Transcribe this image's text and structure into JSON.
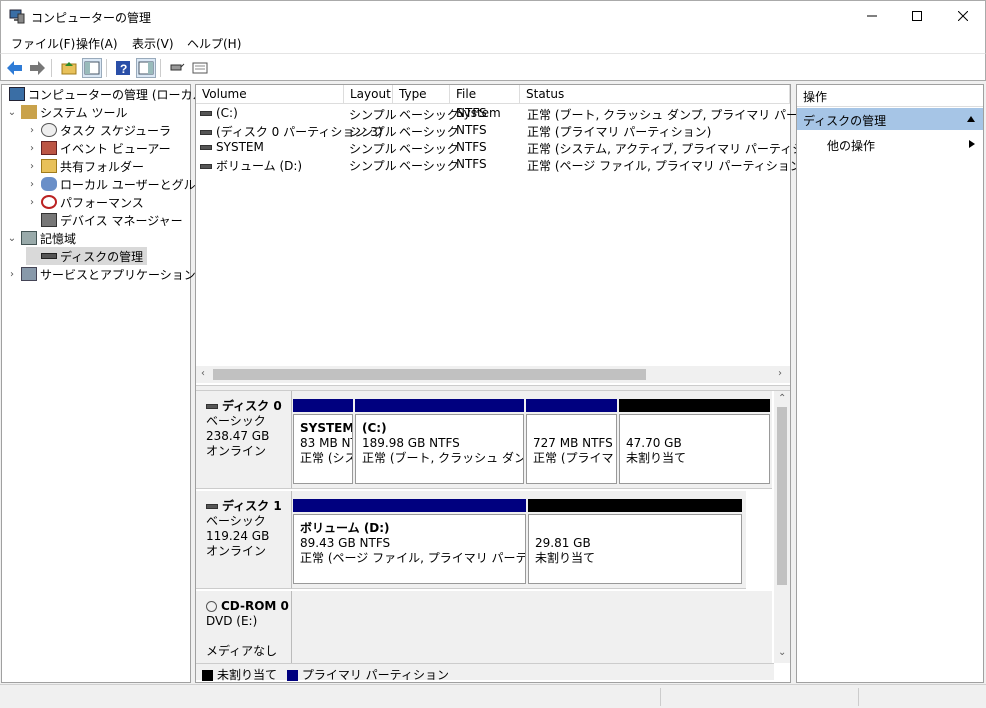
{
  "window": {
    "title": "コンピューターの管理"
  },
  "menu": [
    "ファイル(F)",
    "操作(A)",
    "表示(V)",
    "ヘルプ(H)"
  ],
  "tree": {
    "root": "コンピューターの管理 (ローカル)",
    "system_tools": "システム ツール",
    "task_scheduler": "タスク スケジューラ",
    "event_viewer": "イベント ビューアー",
    "shared_folders": "共有フォルダー",
    "local_users": "ローカル ユーザーとグループ",
    "performance": "パフォーマンス",
    "device_manager": "デバイス マネージャー",
    "storage": "記憶域",
    "disk_management": "ディスクの管理",
    "services_apps": "サービスとアプリケーション"
  },
  "volume_table": {
    "headers": [
      "Volume",
      "Layout",
      "Type",
      "File System",
      "Status"
    ],
    "rows": [
      [
        "(C:)",
        "シンプル",
        "ベーシック",
        "NTFS",
        "正常 (ブート, クラッシュ ダンプ, プライマリ パーティション)"
      ],
      [
        "(ディスク 0 パーティション 3)",
        "シンプル",
        "ベーシック",
        "NTFS",
        "正常 (プライマリ パーティション)"
      ],
      [
        "SYSTEM",
        "シンプル",
        "ベーシック",
        "NTFS",
        "正常 (システム, アクティブ, プライマリ パーティション)"
      ],
      [
        "ボリューム (D:)",
        "シンプル",
        "ベーシック",
        "NTFS",
        "正常 (ページ ファイル, プライマリ パーティション)"
      ]
    ]
  },
  "disks": [
    {
      "name": "ディスク 0",
      "type": "ベーシック",
      "size": "238.47 GB",
      "state": "オンライン",
      "partitions": [
        {
          "kind": "primary",
          "title": "SYSTEM",
          "size": "83 MB NT",
          "status": "正常 (シス"
        },
        {
          "kind": "primary",
          "title": "(C:)",
          "size": "189.98 GB NTFS",
          "status": "正常 (ブート, クラッシュ ダンプ, プラ"
        },
        {
          "kind": "primary",
          "title": "",
          "size": "727 MB NTFS",
          "status": "正常 (プライマリ"
        },
        {
          "kind": "unalloc",
          "title": "",
          "size": "47.70 GB",
          "status": "未割り当て"
        }
      ]
    },
    {
      "name": "ディスク 1",
      "type": "ベーシック",
      "size": "119.24 GB",
      "state": "オンライン",
      "partitions": [
        {
          "kind": "primary",
          "title": "ボリューム (D:)",
          "size": "89.43 GB NTFS",
          "status": "正常 (ページ ファイル, プライマリ パーティション)"
        },
        {
          "kind": "unalloc",
          "title": "",
          "size": "29.81 GB",
          "status": "未割り当て"
        }
      ]
    },
    {
      "name": "CD-ROM 0",
      "type": "DVD (E:)",
      "size": "",
      "state": "メディアなし"
    }
  ],
  "legend": {
    "unallocated": "未割り当て",
    "primary": "プライマリ パーティション",
    "unalloc_color": "#000000",
    "primary_color": "#00007f"
  },
  "actions": {
    "header": "操作",
    "section": "ディスクの管理",
    "more": "他の操作"
  }
}
